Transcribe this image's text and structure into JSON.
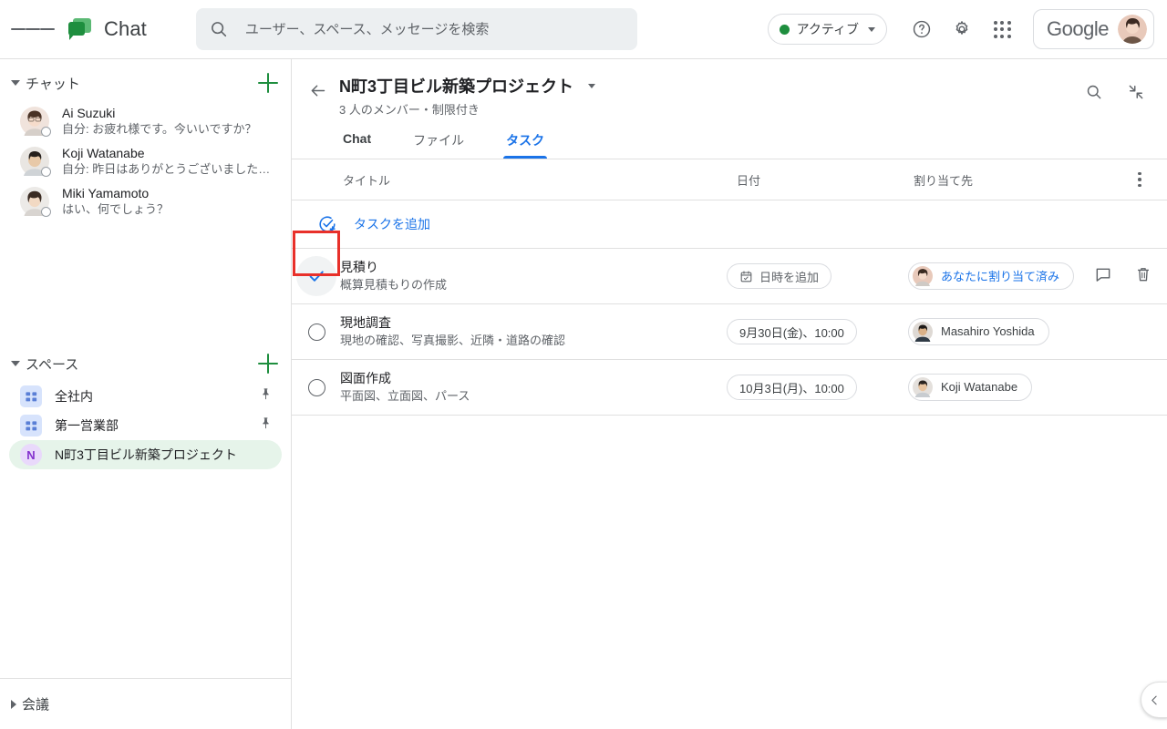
{
  "app": {
    "brand": "Chat",
    "menu_icon": "hamburger-icon",
    "logo_icon": "google-chat-logo"
  },
  "search": {
    "placeholder": "ユーザー、スペース、メッセージを検索",
    "value": "",
    "icon": "search-icon"
  },
  "top_right": {
    "status_label": "アクティブ",
    "status_color": "#1e8e3e",
    "help_icon": "help-circle-icon",
    "settings_icon": "gear-icon",
    "apps_icon": "apps-grid-icon",
    "account_label": "Google",
    "avatar_icon": "user-avatar"
  },
  "sidebar": {
    "chat_section": {
      "title": "チャット",
      "add_label": "+",
      "items": [
        {
          "name": "Ai Suzuki",
          "preview": "自分: お疲れ様です。今いいですか？"
        },
        {
          "name": "Koji Watanabe",
          "preview": "自分: 昨日はありがとうございました…"
        },
        {
          "name": "Miki Yamamoto",
          "preview": "はい、何でしょう？"
        }
      ]
    },
    "spaces_section": {
      "title": "スペース",
      "add_label": "+",
      "items": [
        {
          "label": "全社内",
          "icon": "space-grid-icon",
          "pinned": true,
          "selected": false,
          "initial": ""
        },
        {
          "label": "第一営業部",
          "icon": "space-grid-icon",
          "pinned": true,
          "selected": false,
          "initial": ""
        },
        {
          "label": "N町3丁目ビル新築プロジェクト",
          "icon": "space-letter-icon",
          "pinned": false,
          "selected": true,
          "initial": "N"
        }
      ]
    },
    "meet_section": {
      "title": "会議"
    }
  },
  "conversation": {
    "back_icon": "back-arrow-icon",
    "title": "N町3丁目ビル新築プロジェクト",
    "title_caret": "chevron-down-icon",
    "subtitle": "3 人のメンバー・制限付き",
    "search_icon": "search-icon",
    "collapse_icon": "collapse-arrows-icon",
    "tabs": [
      {
        "label": "Chat",
        "state": "dark"
      },
      {
        "label": "ファイル",
        "state": "normal"
      },
      {
        "label": "タスク",
        "state": "active"
      }
    ]
  },
  "tasks": {
    "columns": {
      "title": "タイトル",
      "date": "日付",
      "assignee": "割り当て先",
      "menu_icon": "more-vertical-icon"
    },
    "add_task_label": "タスクを追加",
    "add_task_icon": "add-task-icon",
    "rows": [
      {
        "checked": true,
        "title": "見積り",
        "description": "概算見積もりの作成",
        "date": "日時を追加",
        "date_is_placeholder": true,
        "date_icon": "calendar-icon",
        "assignee": "あなたに割り当て済み",
        "assignee_is_me": true,
        "comment_icon": "comment-icon",
        "delete_icon": "trash-icon"
      },
      {
        "checked": false,
        "title": "現地調査",
        "description": "現地の確認、写真撮影、近隣・道路の確認",
        "date": "9月30日(金)、10:00",
        "date_is_placeholder": false,
        "date_icon": "",
        "assignee": "Masahiro Yoshida",
        "assignee_is_me": false,
        "comment_icon": "",
        "delete_icon": ""
      },
      {
        "checked": false,
        "title": "図面作成",
        "description": "平面図、立面図、パース",
        "date": "10月3日(月)、10:00",
        "date_is_placeholder": false,
        "date_icon": "",
        "assignee": "Koji Watanabe",
        "assignee_is_me": false,
        "comment_icon": "",
        "delete_icon": ""
      }
    ]
  },
  "annotation": {
    "highlight_color": "#e8302a",
    "target": "task-checkbox-row-1"
  },
  "panel_toggle": {
    "icon": "chevron-left-icon"
  }
}
